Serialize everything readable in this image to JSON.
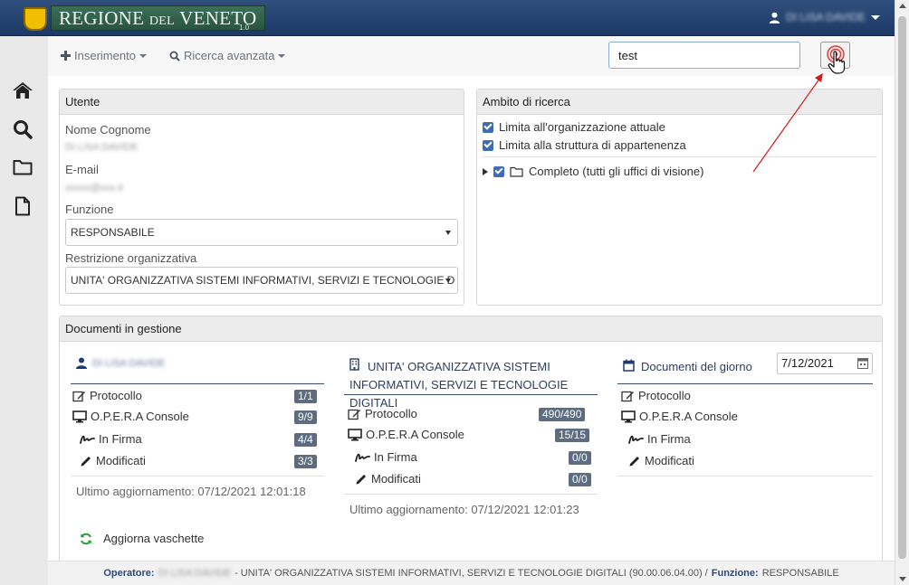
{
  "header": {
    "brand_main": "REGIONE",
    "brand_del": "DEL",
    "brand_end": "VENETO",
    "version": "1.0",
    "user_name": "DI LISA DAVIDE"
  },
  "toolbar": {
    "insert_label": "Inserimento",
    "advanced_search_label": "Ricerca avanzata",
    "search_value": "test"
  },
  "utente": {
    "title": "Utente",
    "name_label": "Nome Cognome",
    "name_value": "DI LISA DAVIDE",
    "email_label": "E-mail",
    "email_value": "xxxxx@xxx.it",
    "funzione_label": "Funzione",
    "funzione_value": "RESPONSABILE",
    "restrizione_label": "Restrizione organizzativa",
    "restrizione_value": "UNITA' ORGANIZZATIVA SISTEMI INFORMATIVI, SERVIZI E TECNOLOGIE D"
  },
  "ambito": {
    "title": "Ambito di ricerca",
    "opt1": "Limita all'organizzazione attuale",
    "opt2": "Limita alla struttura di appartenenza",
    "tree_item": "Completo (tutti gli uffici di visione)"
  },
  "documenti": {
    "title": "Documenti in gestione",
    "col1": {
      "heading": "DI LISA DAVIDE",
      "rows": [
        {
          "label": "Protocollo",
          "count": "1/1"
        },
        {
          "label": "O.P.E.R.A Console",
          "count": "9/9"
        },
        {
          "label": "In Firma",
          "count": "4/4"
        },
        {
          "label": "Modificati",
          "count": "3/3"
        }
      ],
      "updated": "Ultimo aggiornamento: 07/12/2021 12:01:18"
    },
    "col2": {
      "heading_line1": "UNITA' ORGANIZZATIVA SISTEMI",
      "heading_line2": "INFORMATIVI, SERVIZI E TECNOLOGIE DIGITALI",
      "rows": [
        {
          "label": "Protocollo",
          "count": "490/490"
        },
        {
          "label": "O.P.E.R.A Console",
          "count": "15/15"
        },
        {
          "label": "In Firma",
          "count": "0/0"
        },
        {
          "label": "Modificati",
          "count": "0/0"
        }
      ],
      "updated": "Ultimo aggiornamento: 07/12/2021 12:01:23"
    },
    "col3": {
      "heading": "Documenti del giorno",
      "date": "7/12/2021",
      "rows": [
        {
          "label": "Protocollo"
        },
        {
          "label": "O.P.E.R.A Console"
        },
        {
          "label": "In Firma"
        },
        {
          "label": "Modificati"
        }
      ]
    },
    "refresh_label": "Aggiorna vaschette"
  },
  "footer": {
    "operatore_label": "Operatore:",
    "operatore_value": "DI LISA DAVIDE",
    "org_text": "- UNITA' ORGANIZZATIVA SISTEMI INFORMATIVI, SERVIZI E TECNOLOGIE DIGITALI (90.00.06.04.00) /",
    "funzione_label": "Funzione:",
    "funzione_value": "RESPONSABILE"
  },
  "colors": {
    "header_bg": "#1d3a66",
    "accent_blue": "#3f6db3",
    "badge_bg": "#5d6c80",
    "annotation_red": "#d01818",
    "refresh_green": "#2f9a3a"
  }
}
